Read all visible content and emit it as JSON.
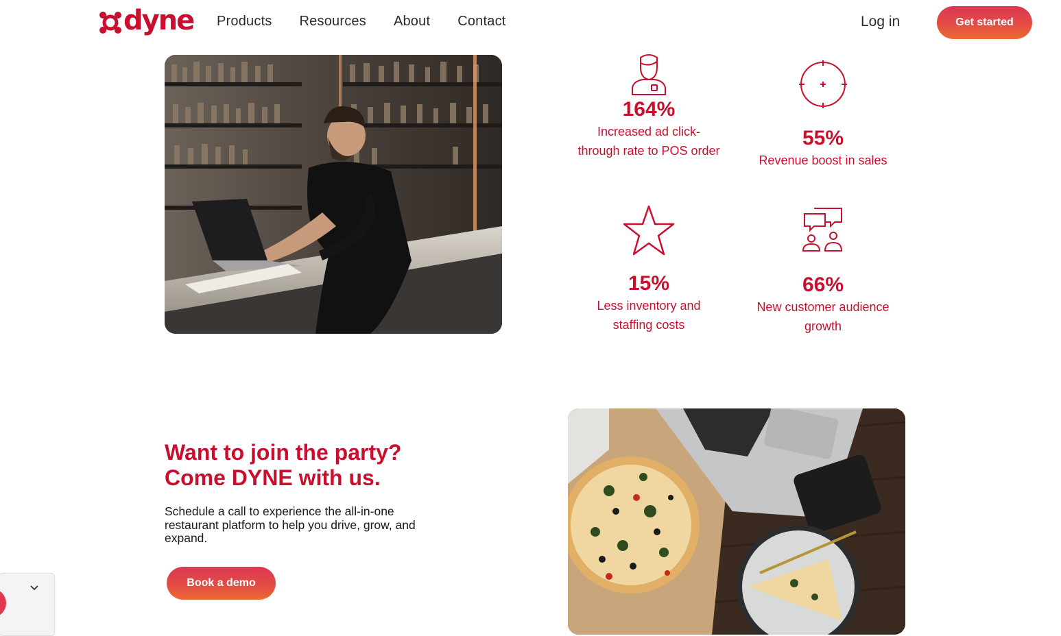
{
  "brand": {
    "name": "dyne",
    "accent": "#c8102e",
    "button_gradient": [
      "#dd3653",
      "#ec6a32"
    ]
  },
  "nav": {
    "items": [
      {
        "label": "Products"
      },
      {
        "label": "Resources"
      },
      {
        "label": "About"
      },
      {
        "label": "Contact"
      }
    ],
    "login_label": "Log in",
    "cta_label": "Get started"
  },
  "images": {
    "bar_photo": {
      "icon": "photo"
    },
    "pizza_photo": {
      "icon": "photo"
    }
  },
  "stats": [
    {
      "icon": "person-icon",
      "value": "164%",
      "label_lines": [
        "Increased ad click-",
        "through rate to POS order"
      ]
    },
    {
      "icon": "target-icon",
      "value": "55%",
      "label_lines": [
        "Revenue boost in sales"
      ]
    },
    {
      "icon": "star-icon",
      "value": "15%",
      "label_lines": [
        "Less inventory and",
        "staffing costs"
      ]
    },
    {
      "icon": "group-chat-icon",
      "value": "66%",
      "label_lines": [
        "New customer audience",
        "growth"
      ]
    }
  ],
  "cta": {
    "title_line1": "Want to join the party?",
    "title_line2": "Come DYNE with us.",
    "text_line1": "Schedule a call to experience the all-in-one",
    "text_line2": "restaurant platform to help you drive, grow, and",
    "text_line3": "expand.",
    "button_label": "Book a demo"
  },
  "widget": {
    "icon": "chevron-down-icon"
  }
}
